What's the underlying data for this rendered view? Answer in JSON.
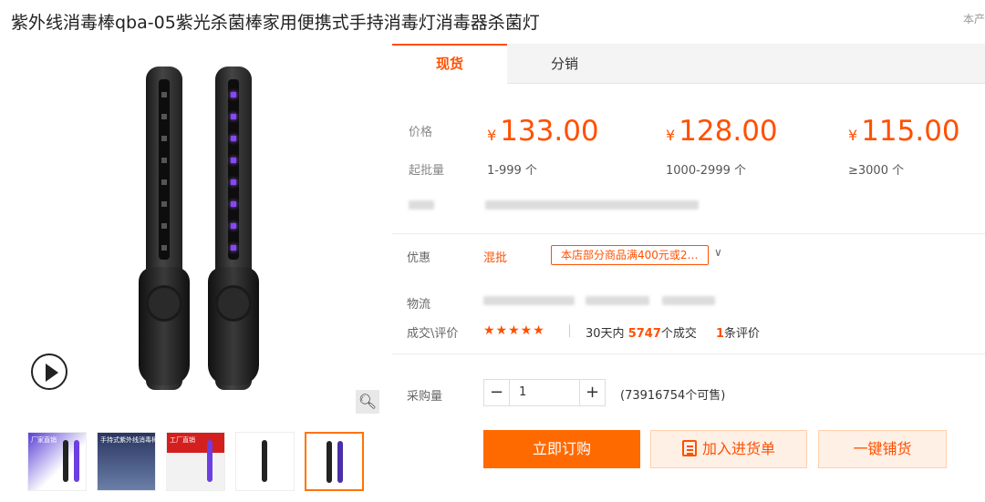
{
  "page": {
    "title": "紫外线消毒棒qba-05紫光杀菌棒家用便携式手持消毒灯消毒器杀菌灯",
    "corner_text": "本产"
  },
  "tabs": [
    {
      "label": "现货",
      "active": true
    },
    {
      "label": "分销",
      "active": false
    }
  ],
  "pricing": {
    "price_label": "价格",
    "moq_label": "起批量",
    "currency": "¥",
    "tiers": [
      {
        "price": "133.00",
        "range": "1-999 个"
      },
      {
        "price": "128.00",
        "range": "1000-2999 个"
      },
      {
        "price": "115.00",
        "range": "≥3000 个"
      }
    ]
  },
  "promotion": {
    "label": "优惠",
    "type": "混批",
    "coupon_text": "本店部分商品满400元或2…"
  },
  "logistics": {
    "label": "物流"
  },
  "deals": {
    "label": "成交\\评价",
    "stars": "★★★★★",
    "sales_prefix": "30天内",
    "sales_count": "5747",
    "sales_suffix": "个成交",
    "review_count": "1",
    "review_suffix": "条评价"
  },
  "purchase": {
    "label": "采购量",
    "minus": "−",
    "plus": "+",
    "quantity": "1",
    "stock_text": "(73916754个可售)"
  },
  "actions": {
    "buy_now": "立即订购",
    "add_to_list": "加入进货单",
    "distribute": "一键铺货"
  },
  "gallery": {
    "thumb_captions": [
      "厂家直销",
      "手持式紫外线消毒棒",
      "工厂直销"
    ],
    "zoom_icon": "magnifier-icon",
    "play_icon": "play-icon"
  },
  "colors": {
    "accent": "#ff5000",
    "button": "#ff6a00",
    "star": "#ff5000"
  }
}
